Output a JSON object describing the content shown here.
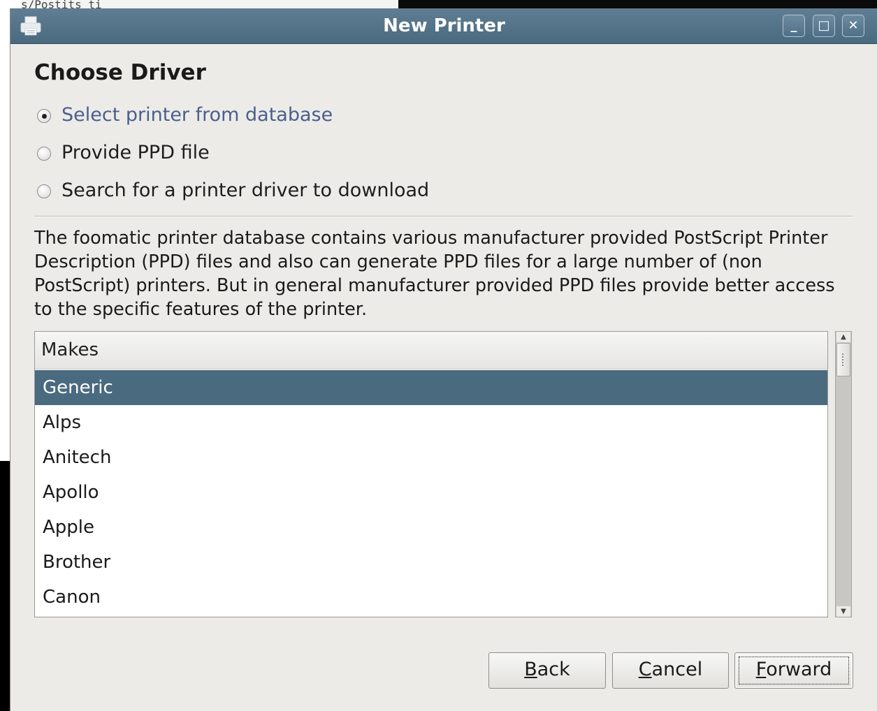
{
  "window": {
    "title": "New Printer",
    "minimize_glyph": "_",
    "maximize_glyph": "□",
    "close_glyph": "✕"
  },
  "heading": "Choose Driver",
  "options": [
    {
      "label": "Select printer from database",
      "checked": true
    },
    {
      "label": "Provide PPD file",
      "checked": false
    },
    {
      "label": "Search for a printer driver to download",
      "checked": false
    }
  ],
  "description": "The foomatic printer database contains various manufacturer provided PostScript Printer Description (PPD) files and also can generate PPD files for a large number of (non PostScript) printers. But in general manufacturer provided PPD files provide better access to the specific features of the printer.",
  "makes": {
    "header": "Makes",
    "items": [
      "Generic",
      "Alps",
      "Anitech",
      "Apollo",
      "Apple",
      "Brother",
      "Canon"
    ],
    "selected": "Generic"
  },
  "buttons": {
    "back": {
      "mnemonic": "B",
      "rest": "ack"
    },
    "cancel": {
      "mnemonic": "C",
      "rest": "ancel"
    },
    "forward": {
      "mnemonic": "F",
      "rest": "orward"
    }
  },
  "background": {
    "top_fragment": "s/Postits ti"
  },
  "colors": {
    "titlebar": "#4a6a80",
    "selection": "#4a6a80",
    "active_option_text": "#4a5f8c",
    "dialog_bg": "#ecebe8"
  }
}
